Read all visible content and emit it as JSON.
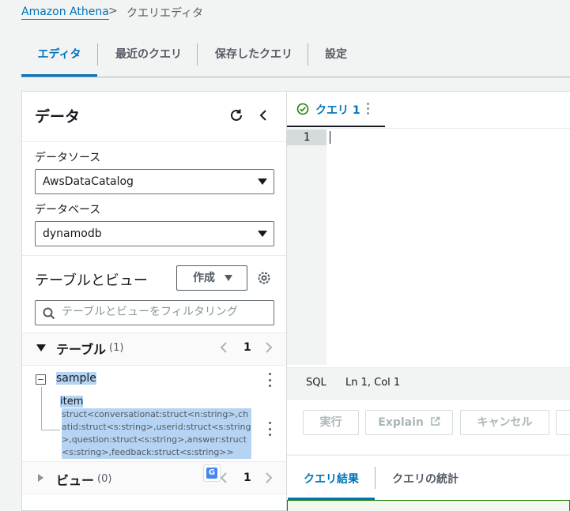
{
  "breadcrumb": {
    "root": "Amazon Athena",
    "separator": ">",
    "current": "クエリエディタ"
  },
  "tabs": [
    {
      "label": "エディタ",
      "active": true
    },
    {
      "label": "最近のクエリ",
      "active": false
    },
    {
      "label": "保存したクエリ",
      "active": false
    },
    {
      "label": "設定",
      "active": false
    }
  ],
  "data_panel": {
    "title": "データ",
    "datasource_label": "データソース",
    "datasource_value": "AwsDataCatalog",
    "database_label": "データベース",
    "database_value": "dynamodb",
    "tables_views_title": "テーブルとビュー",
    "create_button": "作成",
    "filter_placeholder": "テーブルとビューをフィルタリング",
    "tables_section": {
      "label": "テーブル",
      "count": "(1)",
      "page": "1"
    },
    "table": {
      "name": "sample",
      "column_name": "item",
      "column_type": "struct<conversationat:struct<n:string>,chatid:struct<s:string>,userid:struct<s:string>,question:struct<s:string>,answer:struct<s:string>,feedback:struct<s:string>>"
    },
    "views_section": {
      "label": "ビュー",
      "count": "(0)",
      "page": "1"
    }
  },
  "editor": {
    "tab_label": "クエリ 1",
    "line_number": "1",
    "status_lang": "SQL",
    "status_pos": "Ln 1, Col 1"
  },
  "actions": {
    "run": "実行",
    "explain": "Explain",
    "cancel": "キャンセル"
  },
  "results_tabs": [
    {
      "label": "クエリ結果",
      "active": true
    },
    {
      "label": "クエリの統計",
      "active": false
    }
  ],
  "colors": {
    "accent": "#0073bb",
    "success": "#1d8102",
    "selection": "#b5d3f2"
  }
}
